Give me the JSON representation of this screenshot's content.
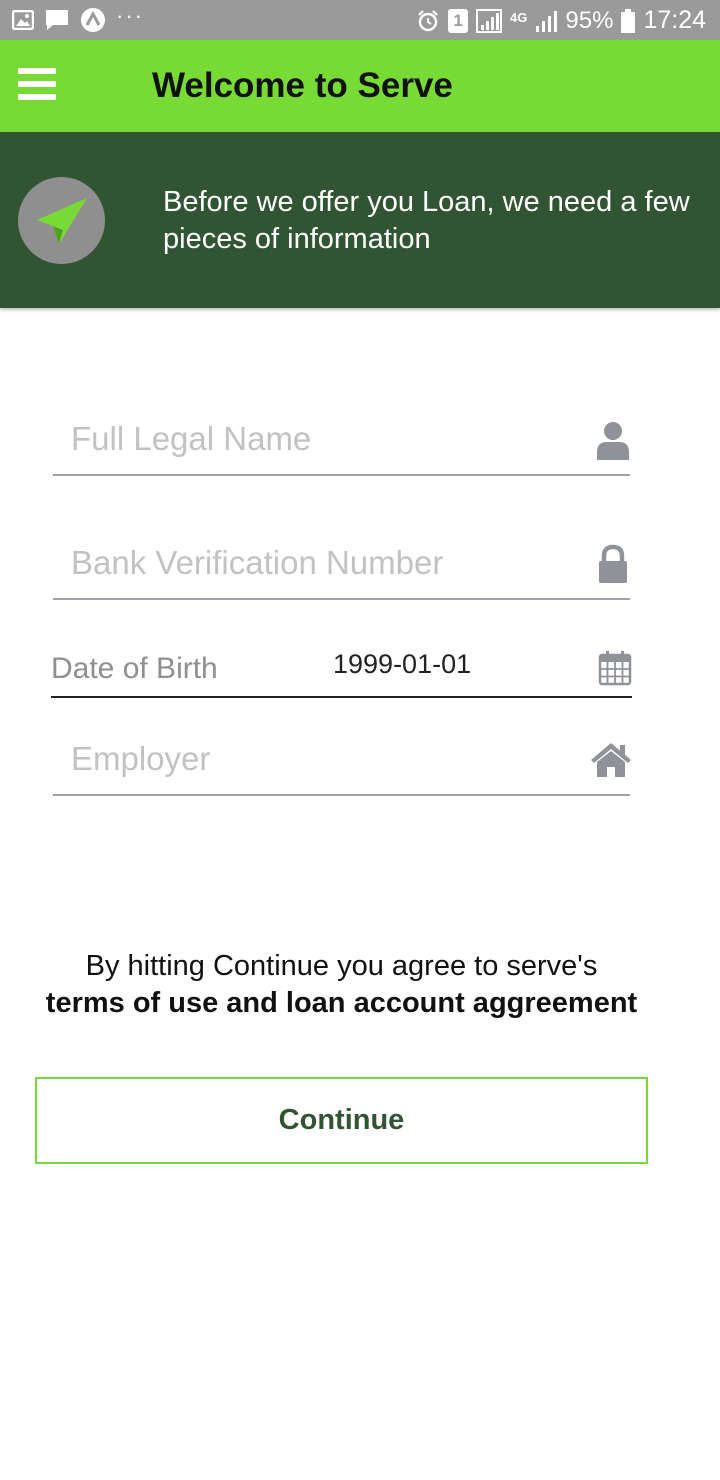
{
  "status_bar": {
    "dots": "···",
    "sim_badge": "1",
    "network": "4G",
    "battery": "95%",
    "time": "17:24"
  },
  "app_bar": {
    "menu_icon": "hamburger-menu-icon",
    "title": "Welcome to Serve",
    "color": "#78db35"
  },
  "banner": {
    "icon": "paper-plane-icon",
    "text": "Before we offer you Loan, we need a few pieces of information",
    "color": "#315533"
  },
  "form": {
    "full_name": {
      "placeholder": "Full Legal Name",
      "value": "",
      "icon": "person-icon"
    },
    "bvn": {
      "placeholder": "Bank Verification Number",
      "value": "",
      "icon": "lock-icon"
    },
    "dob": {
      "label": "Date of Birth",
      "value": "1999-01-01",
      "icon": "calendar-icon"
    },
    "employer": {
      "placeholder": "Employer",
      "value": "",
      "icon": "home-icon"
    }
  },
  "agreement": {
    "text": "By hitting Continue you agree to serve's",
    "link": "terms of use and loan account aggreement"
  },
  "continue_button": {
    "label": "Continue"
  }
}
